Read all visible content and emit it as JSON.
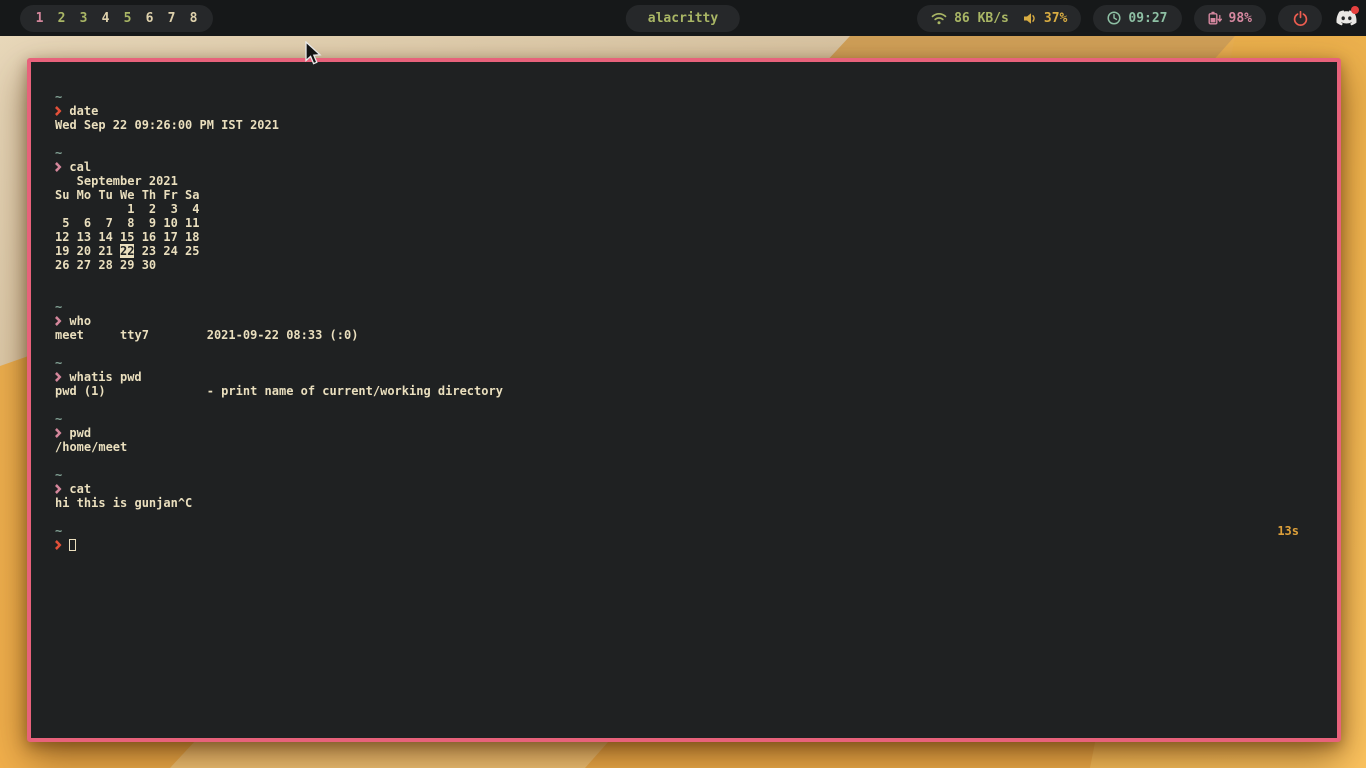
{
  "palette": {
    "bar_bg": "#161819",
    "pill_bg": "#26282a",
    "term_bg": "#1f2122",
    "term_border": "#e7627b",
    "fg": "#eadfbe",
    "path_teal": "#7f9e92",
    "prompt_ok": "#d3869b",
    "prompt_err": "#e25039",
    "dur_yellow": "#dda03a",
    "green": "#a9b665",
    "yellow": "#d8ac42",
    "clock_teal": "#8ec0a4",
    "battery_pink": "#d688a0",
    "power_red": "#ee5d50",
    "discord_white": "#e9e7e4",
    "badge_red": "#e8413f",
    "ws_cream": "#ded1ac"
  },
  "bar": {
    "workspaces": [
      {
        "label": "1",
        "color": "#d3869b"
      },
      {
        "label": "2",
        "color": "#a9b665"
      },
      {
        "label": "3",
        "color": "#a9b665"
      },
      {
        "label": "4",
        "color": "#ded1ac"
      },
      {
        "label": "5",
        "color": "#a9b665"
      },
      {
        "label": "6",
        "color": "#ded1ac"
      },
      {
        "label": "7",
        "color": "#ded1ac"
      },
      {
        "label": "8",
        "color": "#ded1ac"
      }
    ],
    "window_title": "alacritty",
    "network_speed": "86 KB/s",
    "volume_percent": "37%",
    "time": "09:27",
    "battery_percent": "98%",
    "icons": [
      "wifi-icon",
      "volume-icon",
      "clock-icon",
      "battery-charging-icon",
      "power-icon",
      "discord-icon"
    ]
  },
  "terminal": {
    "duration_badge": "13s",
    "lines": [
      {
        "spans": [
          {
            "t": "~",
            "c": "path"
          }
        ]
      },
      {
        "spans": [
          {
            "t": "❯",
            "c": "perr"
          },
          {
            "t": " date",
            "c": "fg"
          }
        ]
      },
      {
        "spans": [
          {
            "t": "Wed Sep 22 09:26:00 PM IST 2021",
            "c": "fg"
          }
        ]
      },
      {
        "spans": []
      },
      {
        "spans": [
          {
            "t": "~",
            "c": "path"
          }
        ]
      },
      {
        "spans": [
          {
            "t": "❯",
            "c": "pok"
          },
          {
            "t": " cal",
            "c": "fg"
          }
        ]
      },
      {
        "spans": [
          {
            "t": "   September 2021",
            "c": "fg"
          }
        ]
      },
      {
        "spans": [
          {
            "t": "Su Mo Tu We Th Fr Sa",
            "c": "fg"
          }
        ]
      },
      {
        "spans": [
          {
            "t": "          1  2  3  4",
            "c": "fg"
          }
        ]
      },
      {
        "spans": [
          {
            "t": " 5  6  7  8  9 10 11",
            "c": "fg"
          }
        ]
      },
      {
        "spans": [
          {
            "t": "12 13 14 15 16 17 18",
            "c": "fg"
          }
        ]
      },
      {
        "spans": [
          {
            "t": "19 20 21 ",
            "c": "fg"
          },
          {
            "t": "22",
            "c": "hl"
          },
          {
            "t": " 23 24 25",
            "c": "fg"
          }
        ]
      },
      {
        "spans": [
          {
            "t": "26 27 28 29 30",
            "c": "fg"
          }
        ]
      },
      {
        "spans": []
      },
      {
        "spans": []
      },
      {
        "spans": [
          {
            "t": "~",
            "c": "path"
          }
        ]
      },
      {
        "spans": [
          {
            "t": "❯",
            "c": "pok"
          },
          {
            "t": " who",
            "c": "fg"
          }
        ]
      },
      {
        "spans": [
          {
            "t": "meet     tty7        2021-09-22 08:33 (:0)",
            "c": "fg"
          }
        ]
      },
      {
        "spans": []
      },
      {
        "spans": [
          {
            "t": "~",
            "c": "path"
          }
        ]
      },
      {
        "spans": [
          {
            "t": "❯",
            "c": "pok"
          },
          {
            "t": " whatis pwd",
            "c": "fg"
          }
        ]
      },
      {
        "spans": [
          {
            "t": "pwd (1)              - print name of current/working directory",
            "c": "fg"
          }
        ]
      },
      {
        "spans": []
      },
      {
        "spans": [
          {
            "t": "~",
            "c": "path"
          }
        ]
      },
      {
        "spans": [
          {
            "t": "❯",
            "c": "pok"
          },
          {
            "t": " pwd",
            "c": "fg"
          }
        ]
      },
      {
        "spans": [
          {
            "t": "/home/meet",
            "c": "fg"
          }
        ]
      },
      {
        "spans": []
      },
      {
        "spans": [
          {
            "t": "~",
            "c": "path"
          }
        ]
      },
      {
        "spans": [
          {
            "t": "❯",
            "c": "pok"
          },
          {
            "t": " cat",
            "c": "fg"
          }
        ]
      },
      {
        "spans": [
          {
            "t": "hi this is gunjan^C",
            "c": "fg"
          }
        ]
      },
      {
        "spans": []
      },
      {
        "spans": [
          {
            "t": "~",
            "c": "path"
          }
        ],
        "right": {
          "t": "13s",
          "c": "dur"
        }
      },
      {
        "spans": [
          {
            "t": "❯",
            "c": "perr"
          },
          {
            "t": " ",
            "c": "fg"
          },
          {
            "t": "",
            "c": "cursor"
          }
        ]
      }
    ]
  }
}
